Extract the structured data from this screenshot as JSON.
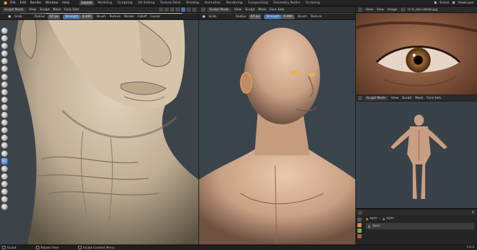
{
  "topbar": {
    "menu": [
      "File",
      "Edit",
      "Render",
      "Window",
      "Help"
    ],
    "workspaces": [
      "Layout",
      "Modeling",
      "Sculpting",
      "UV Editing",
      "Texture Paint",
      "Shading",
      "Animation",
      "Rendering",
      "Compositing",
      "Geometry Nodes",
      "Scripting"
    ],
    "active_workspace": "Layout",
    "scene": "Scene",
    "view_layer": "ViewLayer"
  },
  "left_view": {
    "mode": "Sculpt Mode",
    "menus": [
      "View",
      "Sculpt",
      "Mask",
      "Face Sets"
    ],
    "tool": {
      "name": "Grab",
      "radius_label": "Radius",
      "radius_value": "67 px",
      "strength_label": "Strength",
      "strength_value": "0.400",
      "brush": "Brush",
      "texture": "Texture",
      "stroke": "Stroke",
      "falloff": "Falloff",
      "cursor": "Cursor"
    }
  },
  "mid_view": {
    "mode": "Sculpt Mode",
    "menus": [
      "View",
      "Sculpt",
      "Mask",
      "Face Sets"
    ],
    "tool": {
      "name": "Grab",
      "radius_label": "Radius",
      "radius_value": "67 px",
      "strength_label": "Strength",
      "strength_value": "0.400",
      "brush": "Brush",
      "texture": "Texture"
    }
  },
  "image_editor": {
    "menus": [
      "View",
      "View",
      "Image"
    ],
    "filename": "cc-0_skin-detail.jpg"
  },
  "small_view": {
    "mode": "Sculpt Mode",
    "menus": [
      "View",
      "Sculpt",
      "Mask",
      "Face Sets"
    ]
  },
  "outliner": {
    "breadcrumb_a": "eyes",
    "breadcrumb_b": "eyes",
    "item": "eyes"
  },
  "statusbar": {
    "items": [
      "Sculpt",
      "Rotate View",
      "Sculpt Context Menu"
    ],
    "version": "3.6.2"
  },
  "colors": {
    "accent": "#4772b3",
    "active_tab": "#4a4a4a",
    "viewport_bg": "#3b4247",
    "skin": "#cbb9a0"
  }
}
